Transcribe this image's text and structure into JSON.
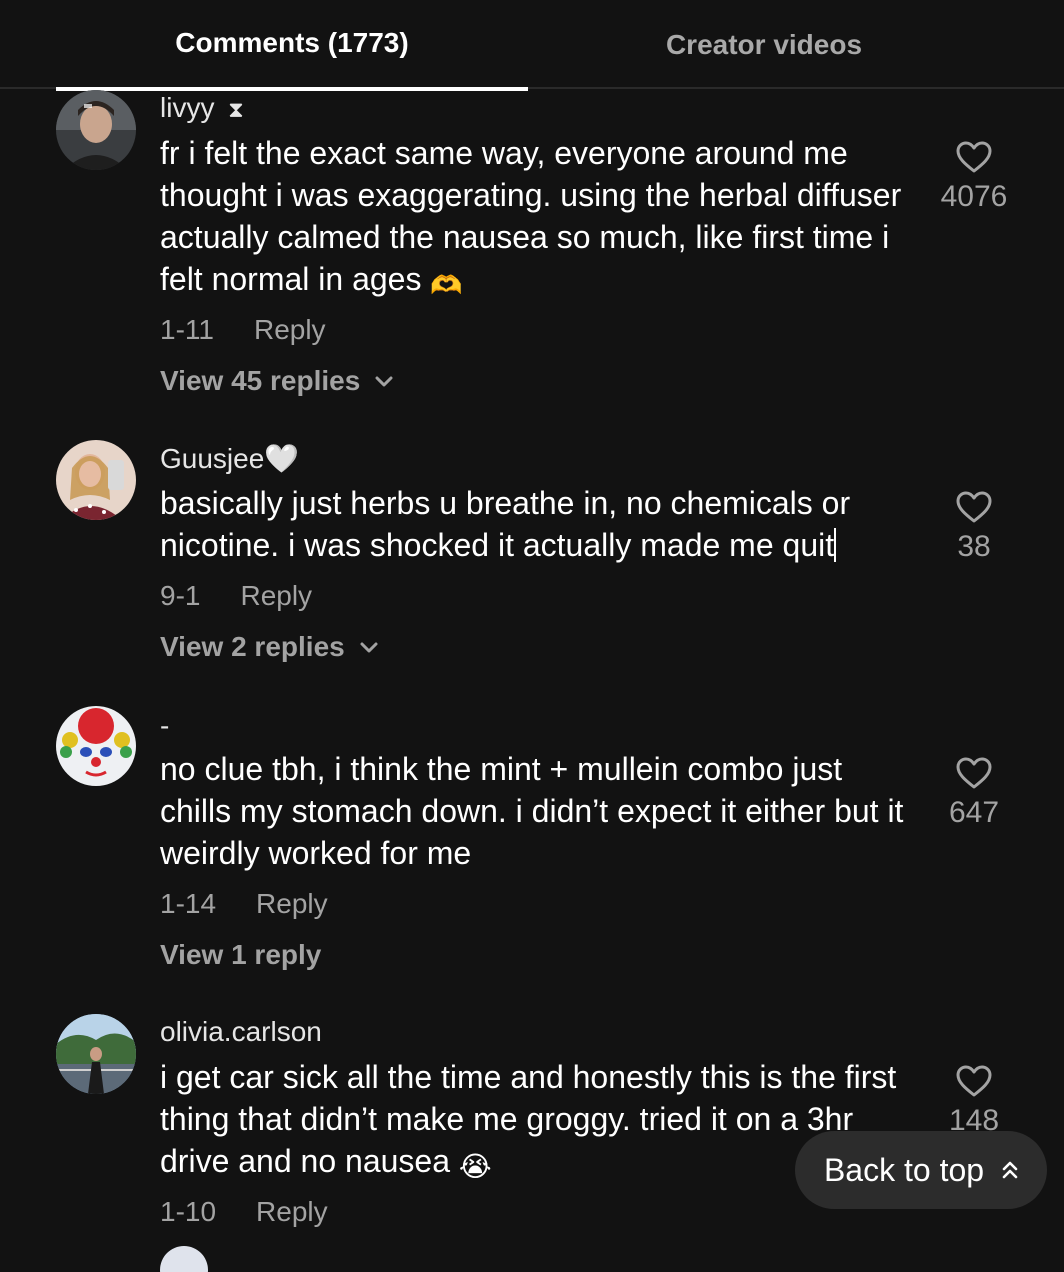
{
  "tabs": {
    "comments": "Comments (1773)",
    "creator": "Creator videos"
  },
  "comments": [
    {
      "username": "livyy",
      "username_suffix": "⧗",
      "text": "fr i felt the exact same way, everyone around me thought i was exaggerating. using the herbal diffuser actually calmed the nausea so much, like first time i felt normal in ages",
      "emoji": "🫶",
      "date": "1-11",
      "reply": "Reply",
      "view_replies": "View 45 replies",
      "likes": "4076"
    },
    {
      "username": "Guusjee🤍",
      "text": "basically just herbs u breathe in, no chemicals or nicotine. i was shocked it actually made me quit",
      "date": "9-1",
      "reply": "Reply",
      "view_replies": "View 2 replies",
      "likes": "38"
    },
    {
      "username": "-",
      "text": "no clue tbh, i think the mint + mullein combo just chills my stomach down. i didn’t expect it either but it weirdly worked for me",
      "date": "1-14",
      "reply": "Reply",
      "view_replies": "View 1 reply",
      "likes": "647"
    },
    {
      "username": "olivia.carlson",
      "text": "i get car sick all the time and honestly this is the first thing that didn’t make me groggy. tried it on a 3hr drive and no nausea",
      "emoji": "😭",
      "date": "1-10",
      "reply": "Reply",
      "likes": "148"
    }
  ],
  "back_to_top": "Back to top",
  "icons": {
    "like": "heart-outline-icon",
    "expand": "chevron-down-icon",
    "back_to_top": "double-chevron-up-icon"
  },
  "colors": {
    "background": "#121212",
    "muted_text": "#a3a3a3",
    "button_bg": "#2c2c2c"
  }
}
